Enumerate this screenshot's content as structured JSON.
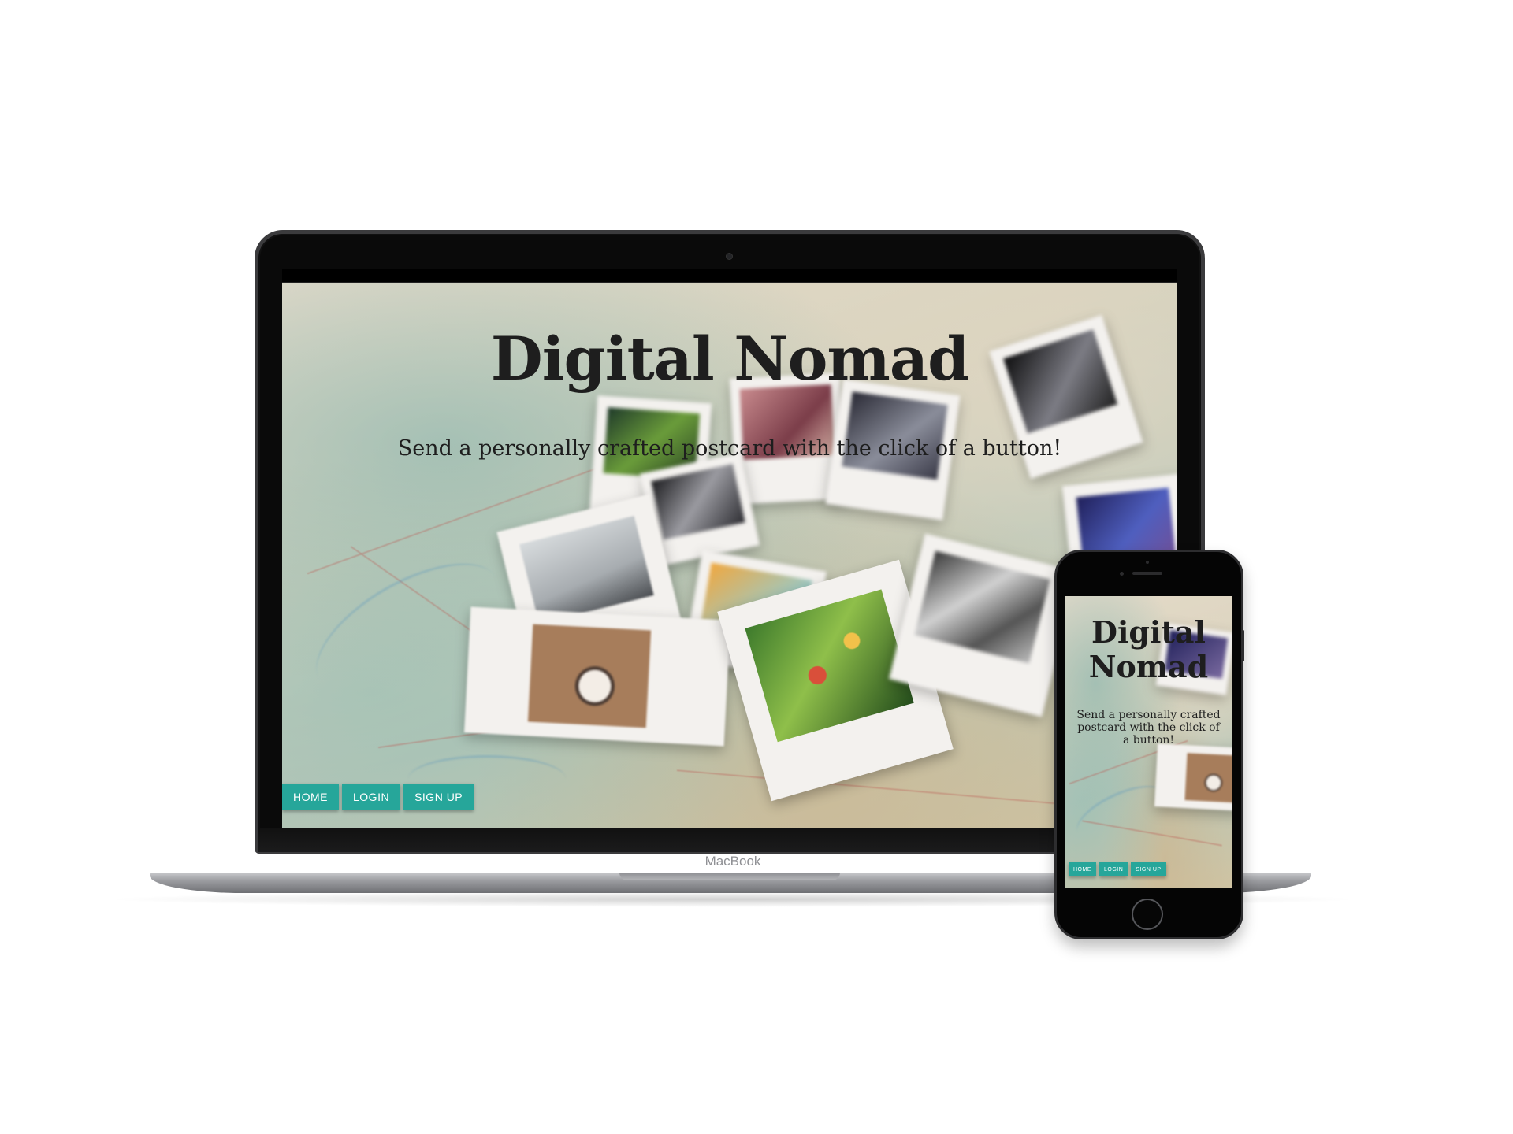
{
  "site": {
    "title": "Digital Nomad",
    "tagline": "Send a personally crafted postcard with the click of a button!",
    "nav": {
      "home": "Home",
      "login": "Login",
      "signup": "Sign Up"
    }
  },
  "device": {
    "laptop_brand": "MacBook"
  },
  "colors": {
    "accent": "#26a69a",
    "heading": "#1e1e1e",
    "page_background": "#ffffff"
  }
}
